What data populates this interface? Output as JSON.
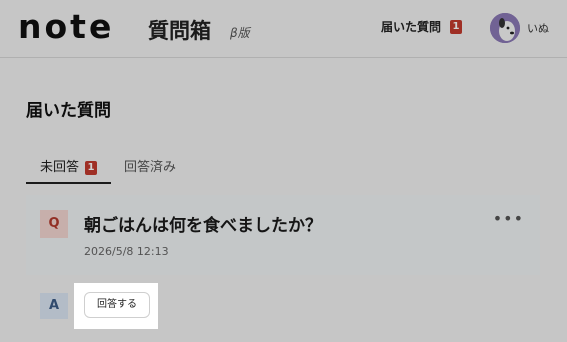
{
  "header": {
    "logo_text": "note",
    "app_title": "質問箱",
    "beta_label": "β版",
    "received_link": "届いた質問",
    "received_badge": "1",
    "user_name": "いぬ",
    "avatar_icon": "dog-avatar-icon"
  },
  "main": {
    "page_title": "届いた質問",
    "tabs": [
      {
        "label": "未回答",
        "badge": "1",
        "active": true
      },
      {
        "label": "回答済み",
        "active": false
      }
    ],
    "question": {
      "marker": "Q",
      "text": "朝ごはんは何を食べましたか？",
      "date": "2026/5/8 12:13",
      "more_icon": "more-horizontal-icon"
    },
    "answer": {
      "marker": "A",
      "button_label": "回答する"
    }
  },
  "colors": {
    "badge": "#c23a2e",
    "q_marker_bg": "#f3d6d1",
    "a_marker_bg": "#dbe6f3"
  }
}
